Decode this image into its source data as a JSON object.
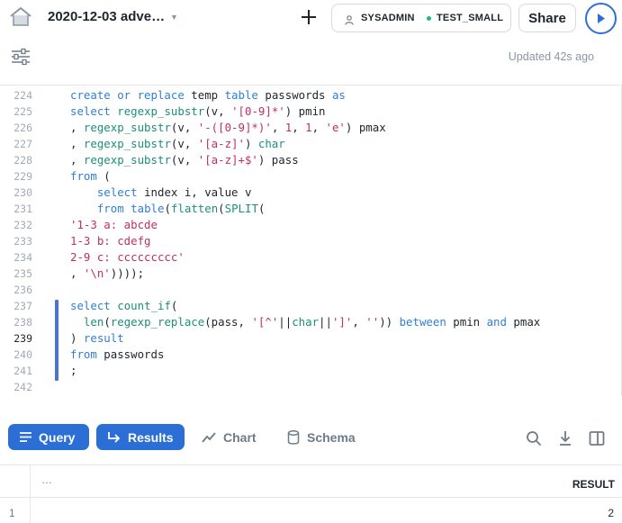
{
  "header": {
    "title": "2020-12-03 adve…",
    "role": "SYSADMIN",
    "warehouse": "TEST_SMALL",
    "share_label": "Share"
  },
  "status": {
    "updated": "Updated 42s ago"
  },
  "editor": {
    "line_numbers": [
      "224",
      "225",
      "226",
      "227",
      "228",
      "229",
      "230",
      "231",
      "232",
      "233",
      "234",
      "235",
      "236",
      "237",
      "238",
      "239",
      "240",
      "241",
      "242"
    ],
    "active_line": "239"
  },
  "tabs": {
    "query": "Query",
    "results": "Results",
    "chart": "Chart",
    "schema": "Schema"
  },
  "results_table": {
    "header_dots": "…",
    "column": "RESULT",
    "rows": [
      {
        "index": "1",
        "value": "2"
      }
    ]
  },
  "colors": {
    "accent": "#2b6ed6",
    "keyword": "#2f7fd6",
    "function": "#1c8f7a",
    "string": "#c1305d",
    "warehouse_dot": "#2bb57d"
  }
}
